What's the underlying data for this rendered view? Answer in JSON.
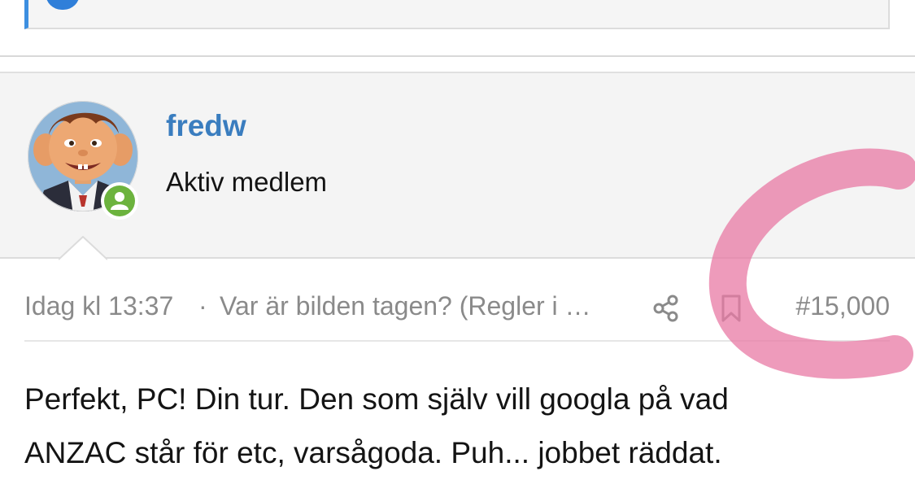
{
  "quote": {
    "avatar_icon": "avatar-circle-icon",
    "accent_color": "#3d8fe0"
  },
  "post": {
    "author": {
      "username": "fredw",
      "title": "Aktiv medlem",
      "avatar_icon": "cartoon-boy-avatar",
      "status_icon": "online-person-icon",
      "status_color": "#6cb33e",
      "username_color": "#3a7dbf"
    },
    "meta": {
      "date": "Idag kl 13:37",
      "separator": "·",
      "thread": "Var är bilden tagen? (Regler i …",
      "share_icon": "share-icon",
      "bookmark_icon": "bookmark-icon",
      "post_number": "#15,000"
    },
    "body": [
      "Perfekt, PC! Din tur. Den som själv vill googla på vad",
      "ANZAC står för etc, varsågoda. Puh... jobbet räddat."
    ]
  },
  "overlay": {
    "annotation_icon": "pink-brush-stroke",
    "color": "#e87aa4"
  }
}
